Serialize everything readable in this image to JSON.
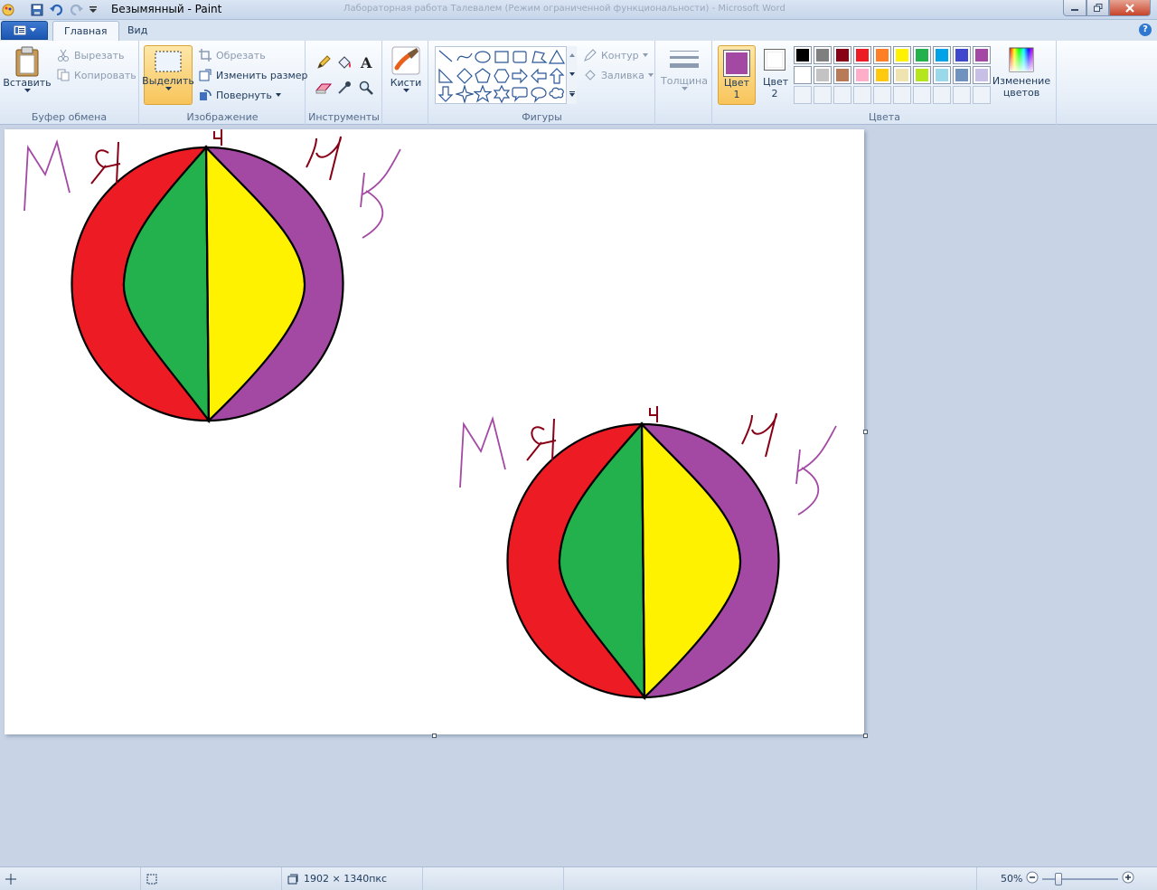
{
  "titlebar": {
    "title": "Безымянный - Paint",
    "background_window_title": "Лабораторная работа Талевалем (Режим ограниченной функциональности) - Microsoft Word"
  },
  "tabs": [
    {
      "label": "Главная",
      "active": true
    },
    {
      "label": "Вид",
      "active": false
    }
  ],
  "clipboard": {
    "paste_label": "Вставить",
    "cut_label": "Вырезать",
    "copy_label": "Копировать",
    "group_label": "Буфер обмена"
  },
  "image": {
    "select_label": "Выделить",
    "crop_label": "Обрезать",
    "resize_label": "Изменить размер",
    "rotate_label": "Повернуть",
    "group_label": "Изображение"
  },
  "tools": {
    "group_label": "Инструменты"
  },
  "brushes": {
    "label": "Кисти"
  },
  "shapes": {
    "outline_label": "Контур",
    "fill_label": "Заливка",
    "group_label": "Фигуры"
  },
  "size": {
    "label": "Толщина"
  },
  "colors": {
    "color1_label": "Цвет 1",
    "color2_label": "Цвет 2",
    "edit_label": "Изменение цветов",
    "group_label": "Цвета",
    "color1": "#a349a4",
    "color2": "#ffffff",
    "palette_row1": [
      "#000000",
      "#7f7f7f",
      "#880015",
      "#ed1c24",
      "#ff7f27",
      "#fff200",
      "#22b14c",
      "#00a2e8",
      "#3f48cc",
      "#a349a4"
    ],
    "palette_row2": [
      "#ffffff",
      "#c3c3c3",
      "#b97a57",
      "#ffaec9",
      "#ffc90e",
      "#efe4b0",
      "#b5e61d",
      "#99d9ea",
      "#7092be",
      "#c8bfe7"
    ]
  },
  "drawing": {
    "fill_colors": {
      "red": "#ed1c24",
      "green": "#22b14c",
      "yellow": "#fff200",
      "purple": "#a349a4",
      "handwriting": "#880015",
      "handwriting2": "#a349a4"
    },
    "handwritten_text": [
      "М",
      "Я",
      "Ч",
      "И",
      "К"
    ]
  },
  "statusbar": {
    "image_size": "1902 × 1340пкс",
    "zoom": "50%"
  }
}
